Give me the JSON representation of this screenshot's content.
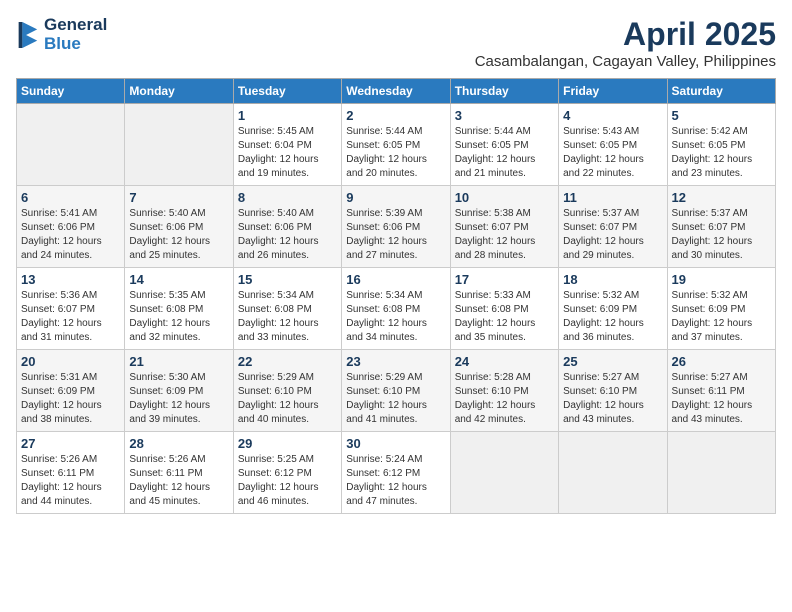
{
  "logo": {
    "general": "General",
    "blue": "Blue"
  },
  "header": {
    "month": "April 2025",
    "location": "Casambalangan, Cagayan Valley, Philippines"
  },
  "weekdays": [
    "Sunday",
    "Monday",
    "Tuesday",
    "Wednesday",
    "Thursday",
    "Friday",
    "Saturday"
  ],
  "weeks": [
    [
      {
        "day": "",
        "info": ""
      },
      {
        "day": "",
        "info": ""
      },
      {
        "day": "1",
        "info": "Sunrise: 5:45 AM\nSunset: 6:04 PM\nDaylight: 12 hours and 19 minutes."
      },
      {
        "day": "2",
        "info": "Sunrise: 5:44 AM\nSunset: 6:05 PM\nDaylight: 12 hours and 20 minutes."
      },
      {
        "day": "3",
        "info": "Sunrise: 5:44 AM\nSunset: 6:05 PM\nDaylight: 12 hours and 21 minutes."
      },
      {
        "day": "4",
        "info": "Sunrise: 5:43 AM\nSunset: 6:05 PM\nDaylight: 12 hours and 22 minutes."
      },
      {
        "day": "5",
        "info": "Sunrise: 5:42 AM\nSunset: 6:05 PM\nDaylight: 12 hours and 23 minutes."
      }
    ],
    [
      {
        "day": "6",
        "info": "Sunrise: 5:41 AM\nSunset: 6:06 PM\nDaylight: 12 hours and 24 minutes."
      },
      {
        "day": "7",
        "info": "Sunrise: 5:40 AM\nSunset: 6:06 PM\nDaylight: 12 hours and 25 minutes."
      },
      {
        "day": "8",
        "info": "Sunrise: 5:40 AM\nSunset: 6:06 PM\nDaylight: 12 hours and 26 minutes."
      },
      {
        "day": "9",
        "info": "Sunrise: 5:39 AM\nSunset: 6:06 PM\nDaylight: 12 hours and 27 minutes."
      },
      {
        "day": "10",
        "info": "Sunrise: 5:38 AM\nSunset: 6:07 PM\nDaylight: 12 hours and 28 minutes."
      },
      {
        "day": "11",
        "info": "Sunrise: 5:37 AM\nSunset: 6:07 PM\nDaylight: 12 hours and 29 minutes."
      },
      {
        "day": "12",
        "info": "Sunrise: 5:37 AM\nSunset: 6:07 PM\nDaylight: 12 hours and 30 minutes."
      }
    ],
    [
      {
        "day": "13",
        "info": "Sunrise: 5:36 AM\nSunset: 6:07 PM\nDaylight: 12 hours and 31 minutes."
      },
      {
        "day": "14",
        "info": "Sunrise: 5:35 AM\nSunset: 6:08 PM\nDaylight: 12 hours and 32 minutes."
      },
      {
        "day": "15",
        "info": "Sunrise: 5:34 AM\nSunset: 6:08 PM\nDaylight: 12 hours and 33 minutes."
      },
      {
        "day": "16",
        "info": "Sunrise: 5:34 AM\nSunset: 6:08 PM\nDaylight: 12 hours and 34 minutes."
      },
      {
        "day": "17",
        "info": "Sunrise: 5:33 AM\nSunset: 6:08 PM\nDaylight: 12 hours and 35 minutes."
      },
      {
        "day": "18",
        "info": "Sunrise: 5:32 AM\nSunset: 6:09 PM\nDaylight: 12 hours and 36 minutes."
      },
      {
        "day": "19",
        "info": "Sunrise: 5:32 AM\nSunset: 6:09 PM\nDaylight: 12 hours and 37 minutes."
      }
    ],
    [
      {
        "day": "20",
        "info": "Sunrise: 5:31 AM\nSunset: 6:09 PM\nDaylight: 12 hours and 38 minutes."
      },
      {
        "day": "21",
        "info": "Sunrise: 5:30 AM\nSunset: 6:09 PM\nDaylight: 12 hours and 39 minutes."
      },
      {
        "day": "22",
        "info": "Sunrise: 5:29 AM\nSunset: 6:10 PM\nDaylight: 12 hours and 40 minutes."
      },
      {
        "day": "23",
        "info": "Sunrise: 5:29 AM\nSunset: 6:10 PM\nDaylight: 12 hours and 41 minutes."
      },
      {
        "day": "24",
        "info": "Sunrise: 5:28 AM\nSunset: 6:10 PM\nDaylight: 12 hours and 42 minutes."
      },
      {
        "day": "25",
        "info": "Sunrise: 5:27 AM\nSunset: 6:10 PM\nDaylight: 12 hours and 43 minutes."
      },
      {
        "day": "26",
        "info": "Sunrise: 5:27 AM\nSunset: 6:11 PM\nDaylight: 12 hours and 43 minutes."
      }
    ],
    [
      {
        "day": "27",
        "info": "Sunrise: 5:26 AM\nSunset: 6:11 PM\nDaylight: 12 hours and 44 minutes."
      },
      {
        "day": "28",
        "info": "Sunrise: 5:26 AM\nSunset: 6:11 PM\nDaylight: 12 hours and 45 minutes."
      },
      {
        "day": "29",
        "info": "Sunrise: 5:25 AM\nSunset: 6:12 PM\nDaylight: 12 hours and 46 minutes."
      },
      {
        "day": "30",
        "info": "Sunrise: 5:24 AM\nSunset: 6:12 PM\nDaylight: 12 hours and 47 minutes."
      },
      {
        "day": "",
        "info": ""
      },
      {
        "day": "",
        "info": ""
      },
      {
        "day": "",
        "info": ""
      }
    ]
  ]
}
